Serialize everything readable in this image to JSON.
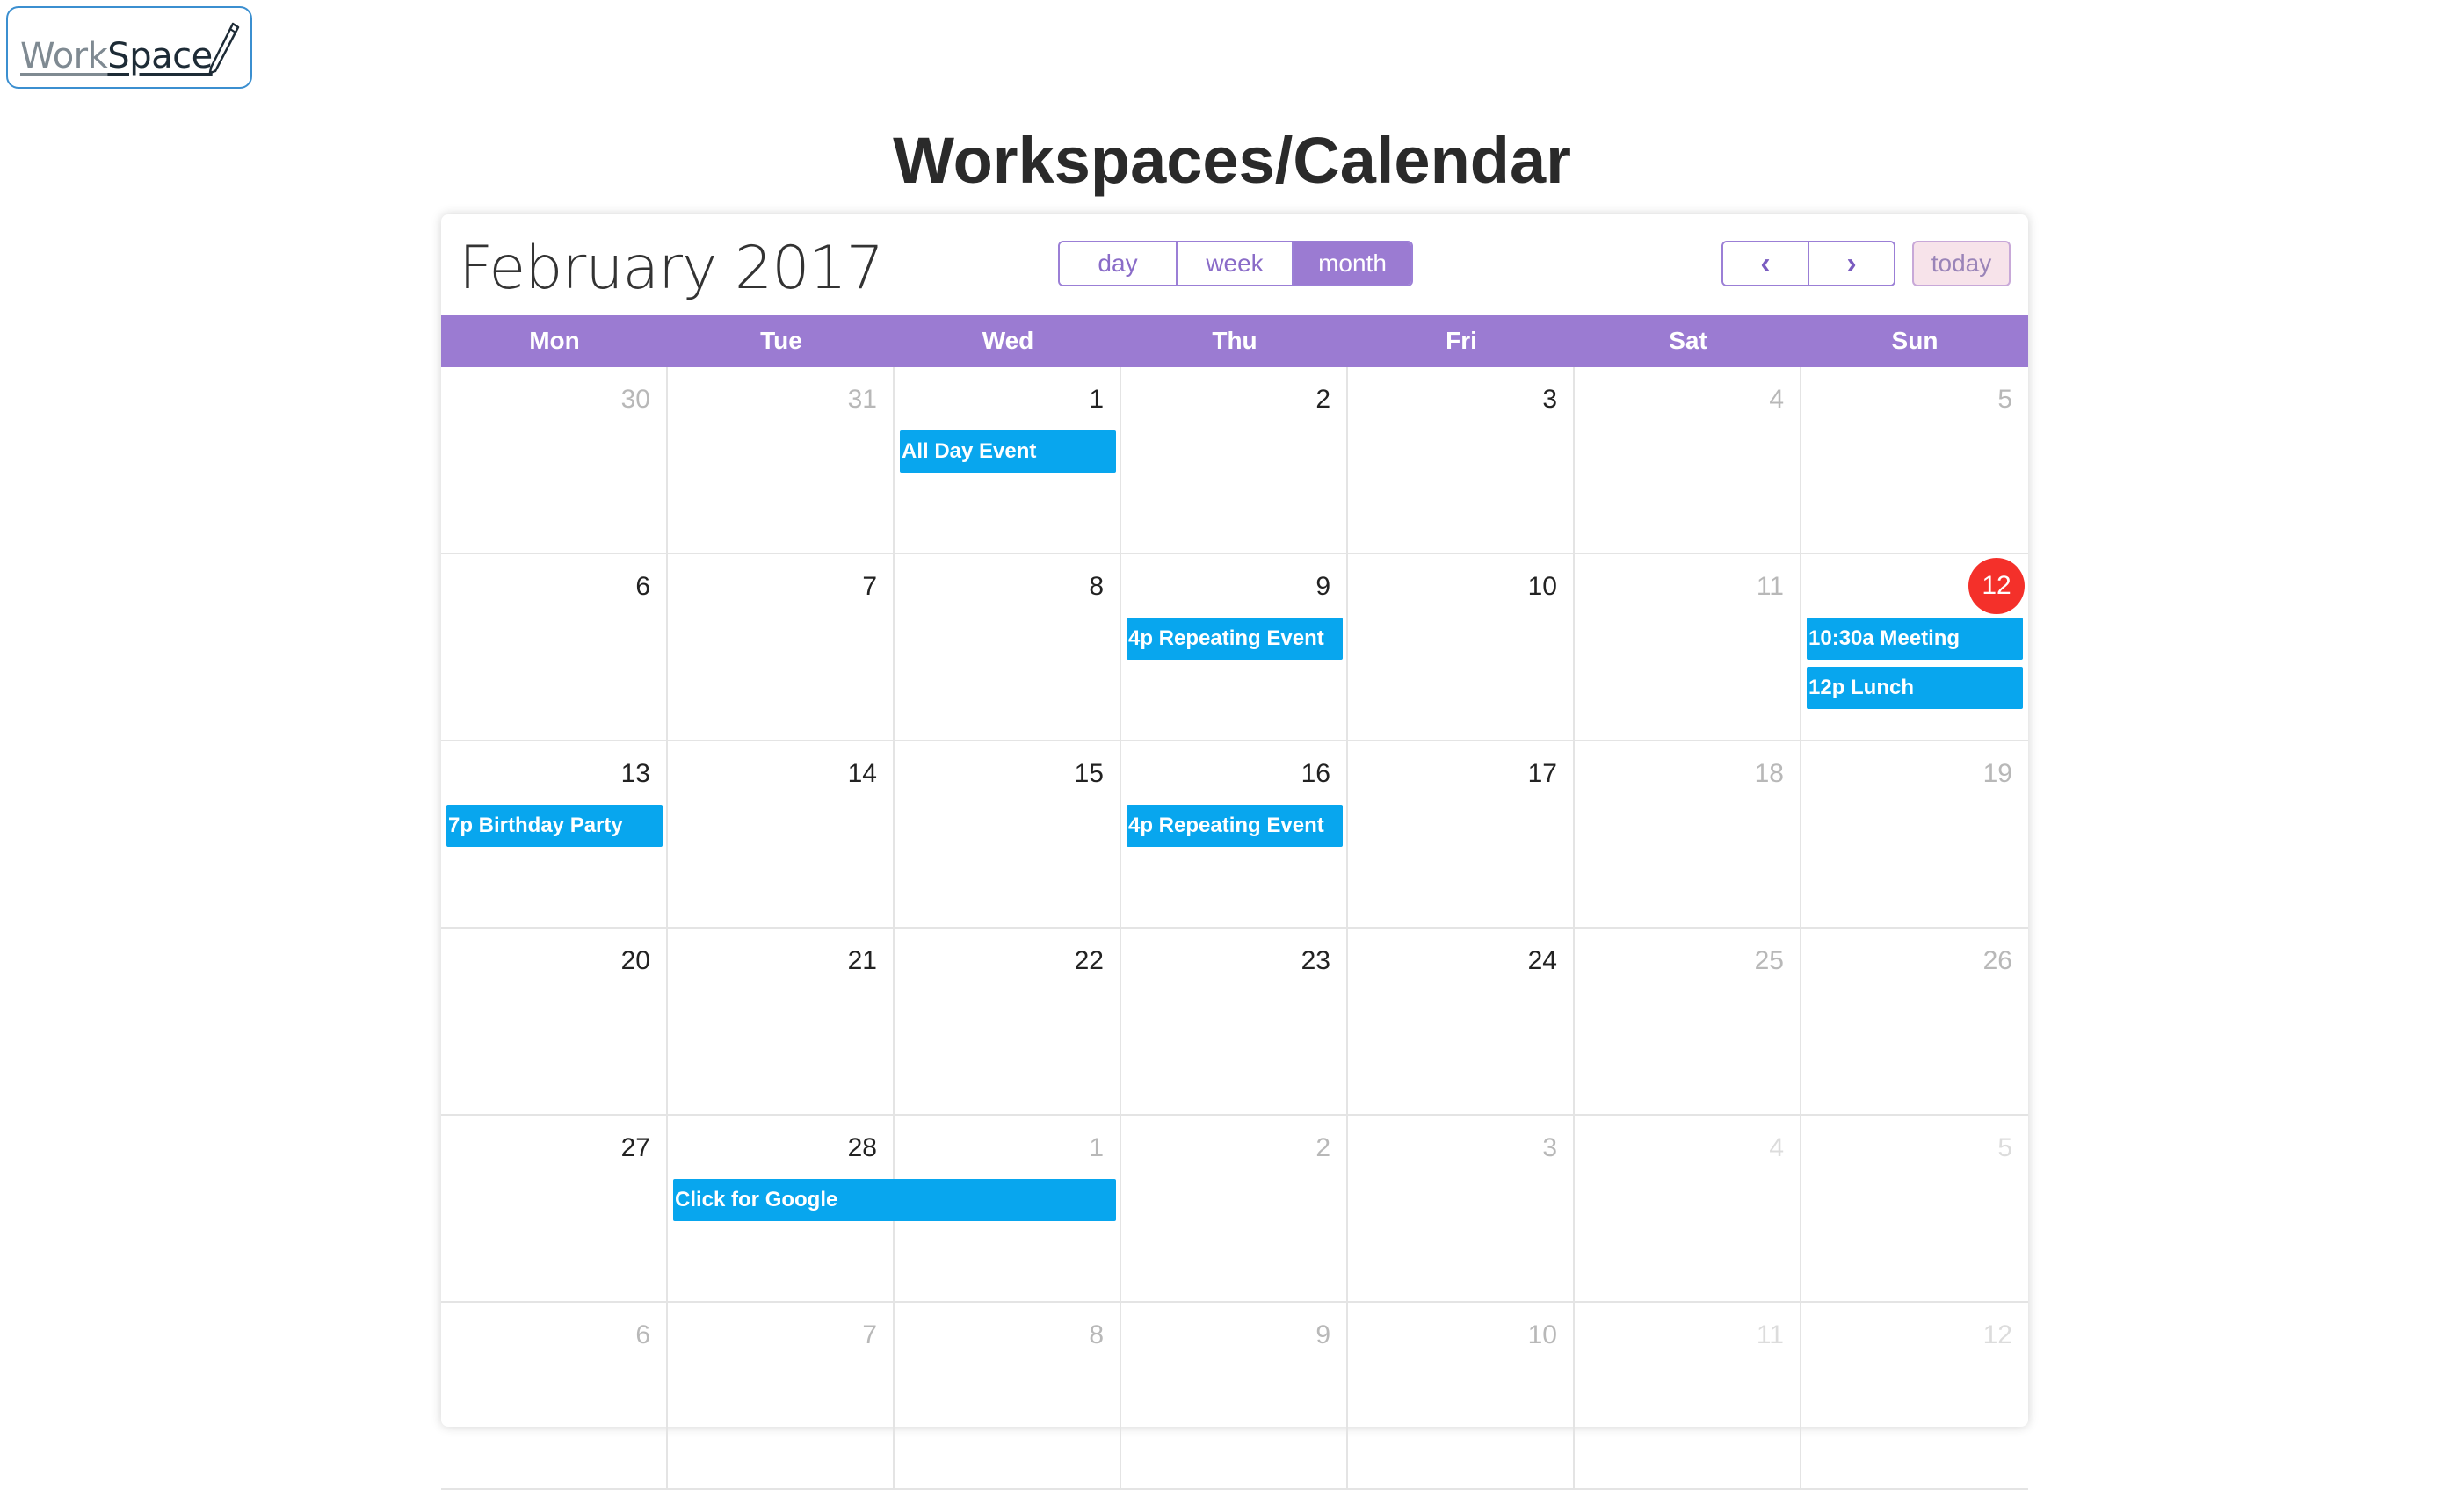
{
  "logo": {
    "part1": "Work",
    "part2": "Space"
  },
  "page_title": "Workspaces/Calendar",
  "calendar": {
    "title": "February 2017",
    "views": [
      "day",
      "week",
      "month"
    ],
    "active_view": "month",
    "prev_label": "‹",
    "next_label": "›",
    "today_label": "today",
    "weekdays": [
      "Mon",
      "Tue",
      "Wed",
      "Thu",
      "Fri",
      "Sat",
      "Sun"
    ],
    "weeks": [
      {
        "days": [
          {
            "n": "30",
            "s": "other"
          },
          {
            "n": "31",
            "s": "other"
          },
          {
            "n": "1",
            "s": "cur"
          },
          {
            "n": "2",
            "s": "cur"
          },
          {
            "n": "3",
            "s": "cur"
          },
          {
            "n": "4",
            "s": "other"
          },
          {
            "n": "5",
            "s": "other"
          }
        ]
      },
      {
        "days": [
          {
            "n": "6",
            "s": "cur"
          },
          {
            "n": "7",
            "s": "cur"
          },
          {
            "n": "8",
            "s": "cur"
          },
          {
            "n": "9",
            "s": "cur"
          },
          {
            "n": "10",
            "s": "cur"
          },
          {
            "n": "11",
            "s": "other"
          },
          {
            "n": "12",
            "s": "today"
          }
        ]
      },
      {
        "days": [
          {
            "n": "13",
            "s": "cur"
          },
          {
            "n": "14",
            "s": "cur"
          },
          {
            "n": "15",
            "s": "cur"
          },
          {
            "n": "16",
            "s": "cur"
          },
          {
            "n": "17",
            "s": "cur"
          },
          {
            "n": "18",
            "s": "other"
          },
          {
            "n": "19",
            "s": "other"
          }
        ]
      },
      {
        "days": [
          {
            "n": "20",
            "s": "cur"
          },
          {
            "n": "21",
            "s": "cur"
          },
          {
            "n": "22",
            "s": "cur"
          },
          {
            "n": "23",
            "s": "cur"
          },
          {
            "n": "24",
            "s": "cur"
          },
          {
            "n": "25",
            "s": "other"
          },
          {
            "n": "26",
            "s": "other"
          }
        ]
      },
      {
        "days": [
          {
            "n": "27",
            "s": "cur"
          },
          {
            "n": "28",
            "s": "cur"
          },
          {
            "n": "1",
            "s": "other"
          },
          {
            "n": "2",
            "s": "other"
          },
          {
            "n": "3",
            "s": "other"
          },
          {
            "n": "4",
            "s": "faint"
          },
          {
            "n": "5",
            "s": "faint"
          }
        ]
      },
      {
        "days": [
          {
            "n": "6",
            "s": "other"
          },
          {
            "n": "7",
            "s": "other"
          },
          {
            "n": "8",
            "s": "other"
          },
          {
            "n": "9",
            "s": "other"
          },
          {
            "n": "10",
            "s": "other"
          },
          {
            "n": "11",
            "s": "faint"
          },
          {
            "n": "12",
            "s": "faint"
          }
        ]
      }
    ],
    "events": [
      {
        "label": "All Day Event",
        "week": 0,
        "day": 2,
        "span": 1,
        "slot": 0
      },
      {
        "label": "4p Repeating Event",
        "week": 1,
        "day": 3,
        "span": 1,
        "slot": 0
      },
      {
        "label": "10:30a Meeting",
        "week": 1,
        "day": 6,
        "span": 1,
        "slot": 0
      },
      {
        "label": "12p Lunch",
        "week": 1,
        "day": 6,
        "span": 1,
        "slot": 1
      },
      {
        "label": "7p Birthday Party",
        "week": 2,
        "day": 0,
        "span": 1,
        "slot": 0
      },
      {
        "label": "4p Repeating Event",
        "week": 2,
        "day": 3,
        "span": 1,
        "slot": 0
      },
      {
        "label": "Click for Google",
        "week": 4,
        "day": 1,
        "span": 2,
        "slot": 0
      }
    ],
    "colors": {
      "header": "#9b7bd2",
      "event": "#08a6ee",
      "today": "#f4302a"
    }
  }
}
